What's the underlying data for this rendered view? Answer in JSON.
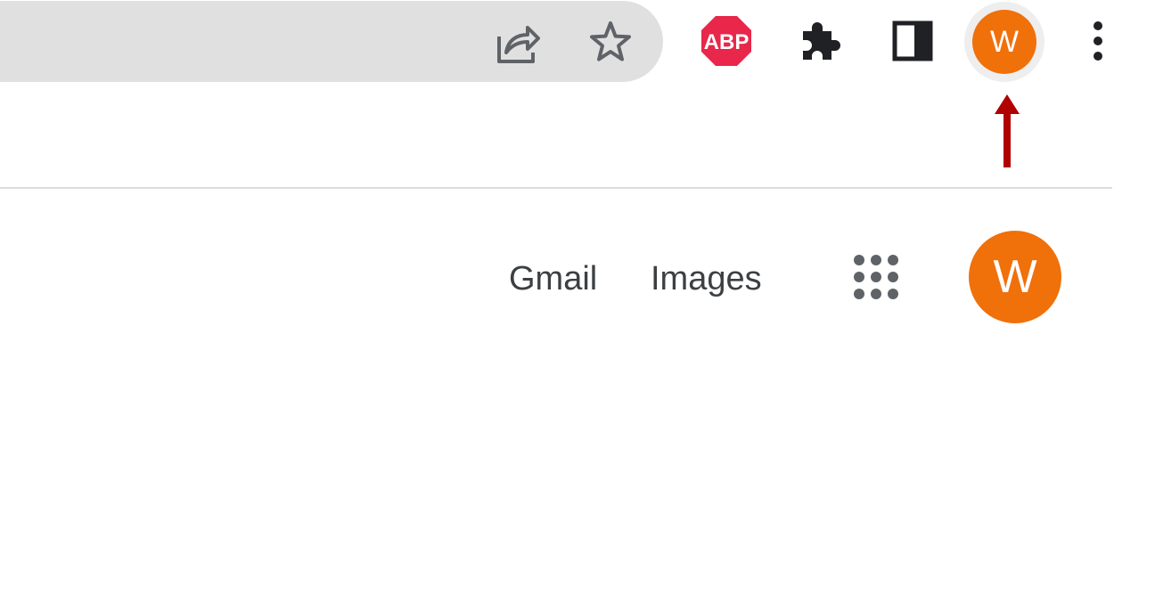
{
  "toolbar": {
    "extension_abp_text": "ABP",
    "profile_initial": "W"
  },
  "google_header": {
    "gmail_label": "Gmail",
    "images_label": "Images",
    "account_initial": "W"
  },
  "colors": {
    "avatar_bg": "#f0700a",
    "abp_red": "#e8274a",
    "annotation_arrow": "#b00000",
    "omnibox_bg": "#e0e0e0"
  },
  "icons": [
    "share-icon",
    "star-icon",
    "adblock-plus-icon",
    "puzzle-extensions-icon",
    "side-panel-icon",
    "more-vert-icon",
    "apps-grid-icon"
  ]
}
